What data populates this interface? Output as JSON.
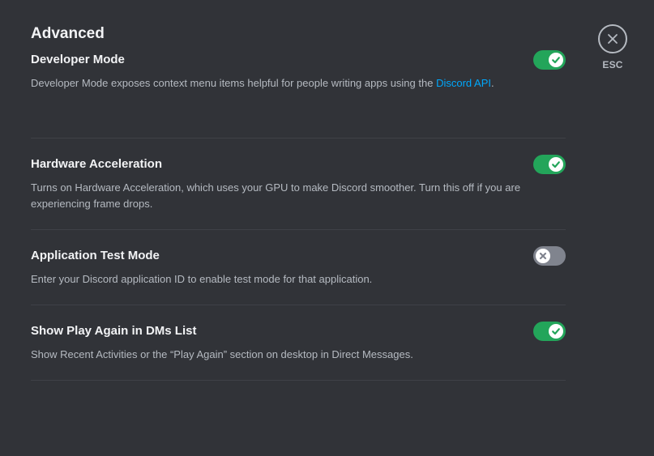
{
  "page": {
    "title": "Advanced"
  },
  "close": {
    "label": "ESC",
    "icon": "close-icon"
  },
  "settings": [
    {
      "title": "Developer Mode",
      "desc_before": "Developer Mode exposes context menu items helpful for people writing apps using the ",
      "desc_link": "Discord API",
      "desc_after": ".",
      "enabled": true
    },
    {
      "title": "Hardware Acceleration",
      "desc": "Turns on Hardware Acceleration, which uses your GPU to make Discord smoother. Turn this off if you are experiencing frame drops.",
      "enabled": true
    },
    {
      "title": "Application Test Mode",
      "desc": "Enter your Discord application ID to enable test mode for that application.",
      "enabled": false
    },
    {
      "title": "Show Play Again in DMs List",
      "desc": "Show Recent Activities or the “Play Again” section on desktop in Direct Messages.",
      "enabled": true
    }
  ],
  "colors": {
    "background": "#313338",
    "toggle_on": "#23a55a",
    "toggle_off": "#80848e",
    "link": "#00a8fc"
  }
}
